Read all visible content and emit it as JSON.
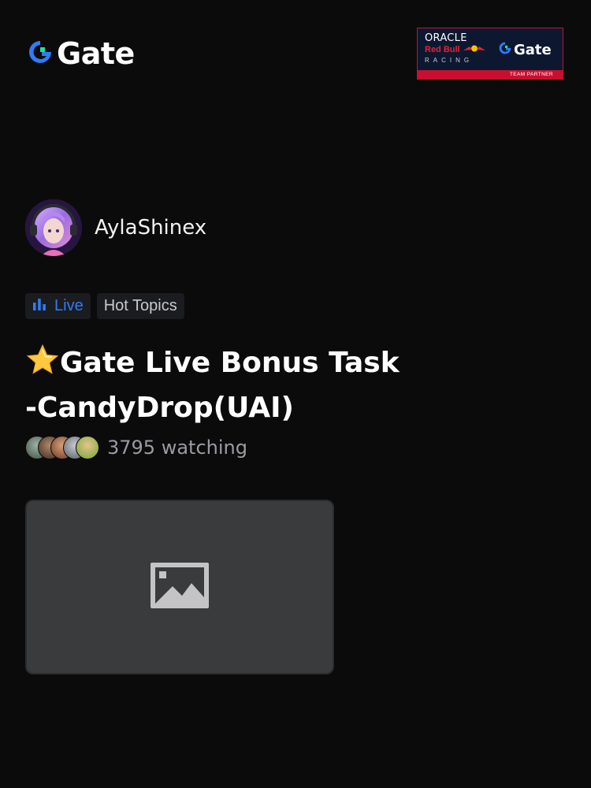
{
  "header": {
    "logo_text": "Gate",
    "logo_icon": "gate-logo-icon",
    "partner_badge": {
      "line1": "ORACLE",
      "line2": "Red Bull",
      "line3": "RACING",
      "brand": "Gate",
      "footer": "TEAM PARTNER"
    }
  },
  "streamer": {
    "name": "AylaShinex",
    "avatar": "avatar-image"
  },
  "tags": [
    {
      "label": "Live",
      "icon": "live-bars-icon",
      "color": "#2f7cf6"
    },
    {
      "label": "Hot Topics"
    }
  ],
  "stream": {
    "title_emoji": "🌟",
    "title": "Gate Live Bonus Task -CandyDrop(UAI)",
    "watching": "3795 watching",
    "thumbnail": "image-placeholder-icon"
  },
  "colors": {
    "background": "#0b0b0c",
    "accent_blue": "#2f7cf6",
    "gate_green": "#17e5a0",
    "partner_red": "#c8102e"
  }
}
